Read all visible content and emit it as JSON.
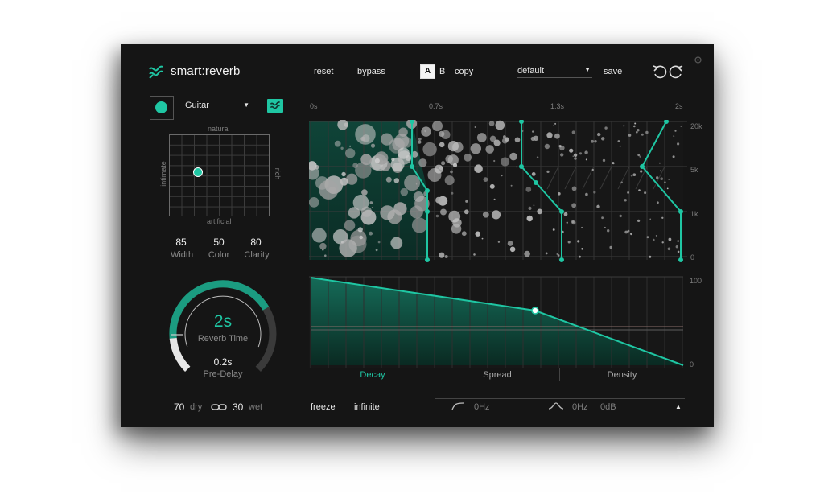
{
  "header": {
    "app_name": "smart:reverb",
    "reset_label": "reset",
    "bypass_label": "bypass",
    "ab": {
      "a_label": "A",
      "b_label": "B"
    },
    "copy_label": "copy",
    "preset": {
      "value": "default"
    },
    "save_label": "save"
  },
  "source": {
    "value": "Guitar"
  },
  "pad": {
    "top": "natural",
    "bottom": "artificial",
    "left": "intimate",
    "right": "rich"
  },
  "params": [
    {
      "value": "85",
      "label": "Width"
    },
    {
      "value": "50",
      "label": "Color"
    },
    {
      "value": "80",
      "label": "Clarity"
    }
  ],
  "knob": {
    "value": "2s",
    "label": "Reverb Time",
    "predelay_value": "0.2s",
    "predelay_label": "Pre-Delay",
    "fill_fraction": 0.72
  },
  "mix": {
    "dry_value": "70",
    "dry_label": "dry",
    "wet_value": "30",
    "wet_label": "wet"
  },
  "bottom": {
    "freeze_label": "freeze",
    "infinite_label": "infinite"
  },
  "filters": {
    "lowcut_value": "0Hz",
    "bell_freq": "0Hz",
    "bell_gain": "0dB"
  },
  "timeline": {
    "ticks": [
      "0s",
      "0.7s",
      "1.3s",
      "2s"
    ]
  },
  "spectrum": {
    "freq_labels": [
      "20k",
      "5k",
      "1k",
      "0"
    ]
  },
  "envelope": {
    "y_labels": [
      "100",
      "0"
    ]
  },
  "tabs": [
    {
      "label": "Decay",
      "active": true
    },
    {
      "label": "Spread",
      "active": false
    },
    {
      "label": "Density",
      "active": false
    }
  ],
  "colors": {
    "accent": "#1fc6a3",
    "background": "#151515"
  }
}
